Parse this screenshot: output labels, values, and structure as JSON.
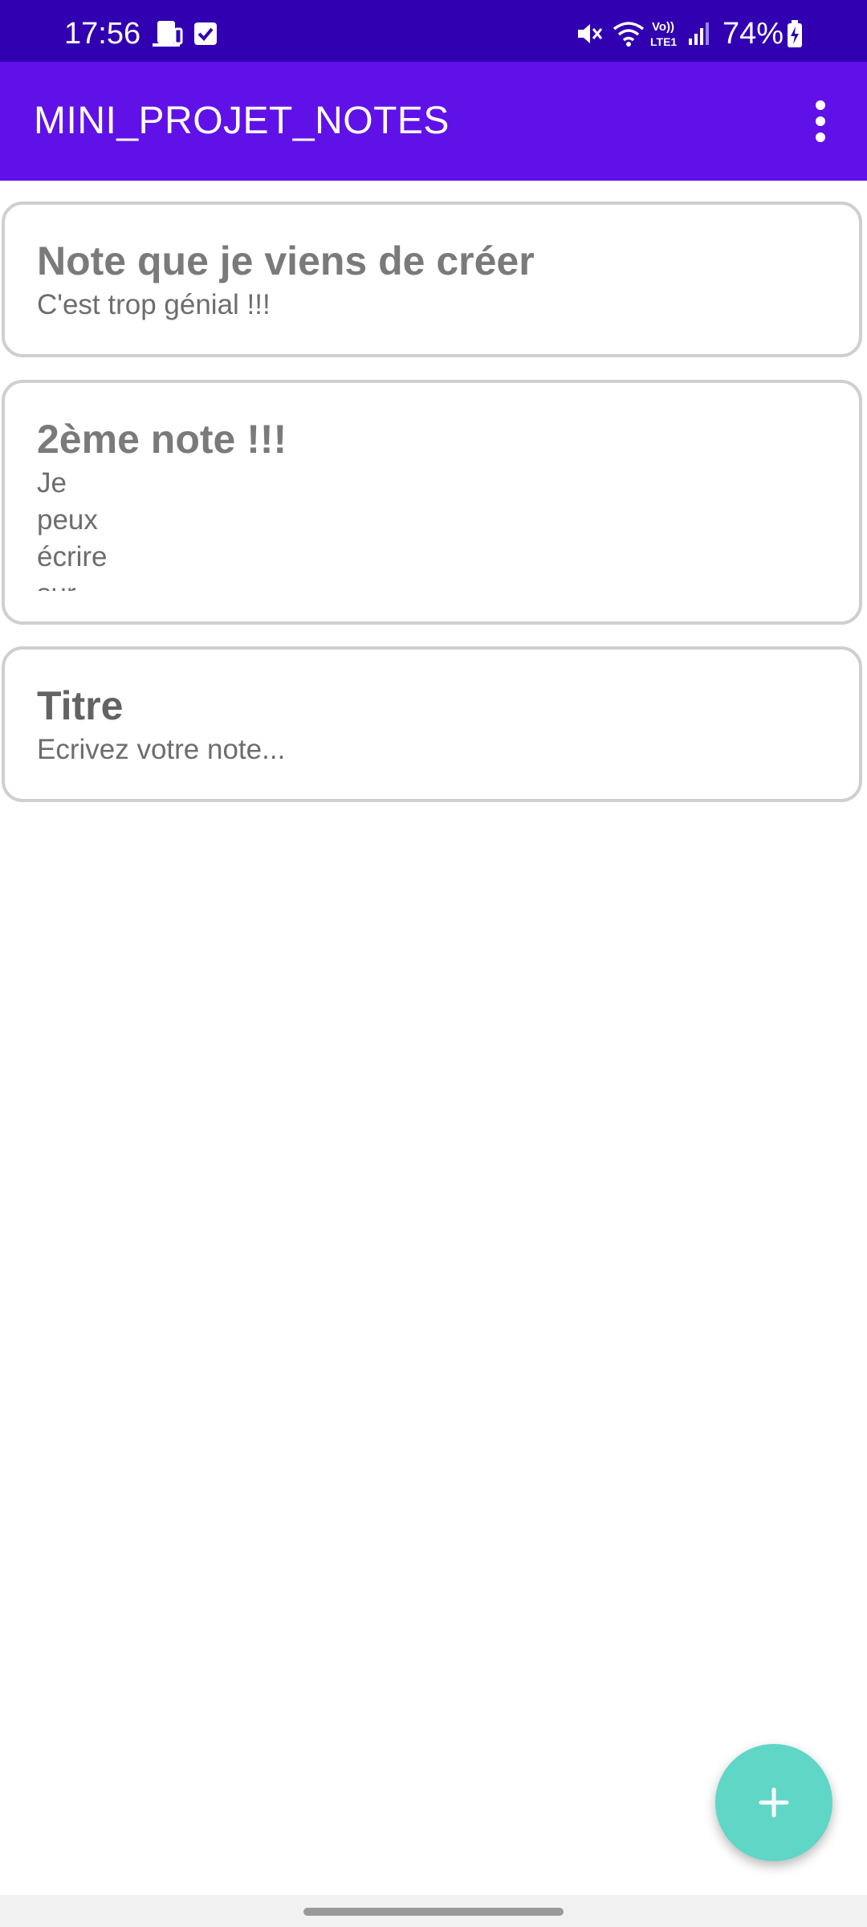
{
  "status_bar": {
    "time": "17:56",
    "battery": "74%",
    "icons": [
      "screen-mirror-icon",
      "checkbox-icon",
      "mute-icon",
      "wifi-icon",
      "volte-icon",
      "signal-icon",
      "battery-charging-icon"
    ],
    "volte_label": "Vo)) LTE1",
    "background": "#3100b0"
  },
  "app_bar": {
    "title": "MINI_PROJET_NOTES",
    "menu_icon": "more-vert-icon",
    "background": "#6011e8"
  },
  "notes": [
    {
      "title": "Note que je viens de créer",
      "body": "C'est trop génial !!!"
    },
    {
      "title": "2ème note !!!",
      "body": "Je\npeux\nécrire\nsur"
    },
    {
      "title": "Titre",
      "body": "Ecrivez votre note..."
    }
  ],
  "fab": {
    "icon": "plus-icon",
    "color": "#5fd6c6"
  }
}
